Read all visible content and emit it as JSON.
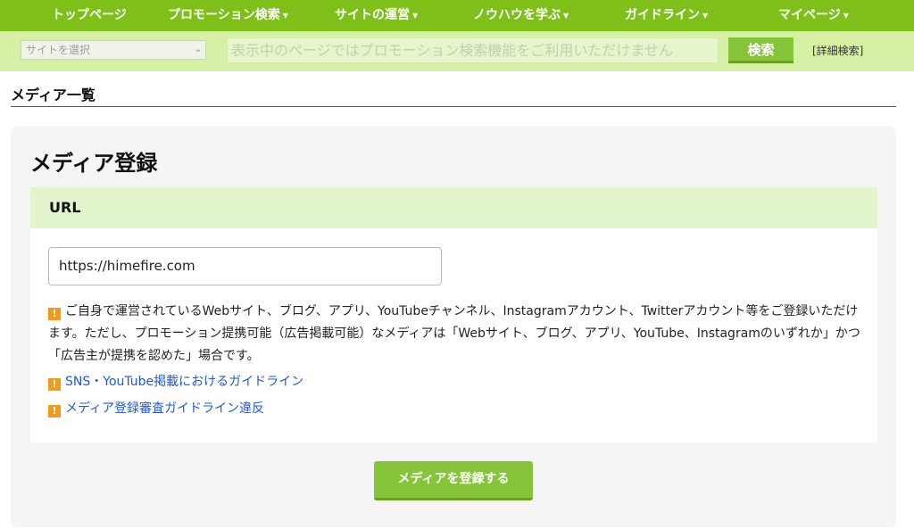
{
  "nav": {
    "items": [
      {
        "label": "トップページ",
        "has_dropdown": false
      },
      {
        "label": "プロモーション検索",
        "has_dropdown": true
      },
      {
        "label": "サイトの運営",
        "has_dropdown": true
      },
      {
        "label": "ノウハウを学ぶ",
        "has_dropdown": true
      },
      {
        "label": "ガイドライン",
        "has_dropdown": true
      },
      {
        "label": "マイページ",
        "has_dropdown": true
      }
    ],
    "caret": "▼"
  },
  "search": {
    "site_select_value": "サイトを選択",
    "placeholder": "表示中のページではプロモーション検索機能をご利用いただけません",
    "button_label": "検索",
    "advanced_link": "[詳細検索]"
  },
  "page": {
    "heading": "メディア一覧"
  },
  "panel": {
    "title": "メディア登録",
    "url_section_label": "URL",
    "url_value": "https://himefire.com",
    "note": "ご自身で運営されているWebサイト、ブログ、アプリ、YouTubeチャンネル、Instagramアカウント、Twitterアカウント等をご登録いただけます。ただし、プロモーション提携可能（広告掲載可能）なメディアは「Webサイト、ブログ、アプリ、YouTube、Instagramのいずれか」かつ「広告主が提携を認めた」場合です。",
    "links": [
      {
        "label": "SNS・YouTube掲載におけるガイドライン"
      },
      {
        "label": "メディア登録審査ガイドライン違反"
      }
    ],
    "warn_icon": "!",
    "register_button": "メディアを登録する"
  },
  "colors": {
    "nav_bg": "#7fbf1a",
    "searchbar_bg": "#d6f0a6",
    "accent_button": "#86c43a",
    "url_header_bg": "#e3f5cc",
    "link": "#2357d6",
    "warning": "#f39a1c"
  }
}
